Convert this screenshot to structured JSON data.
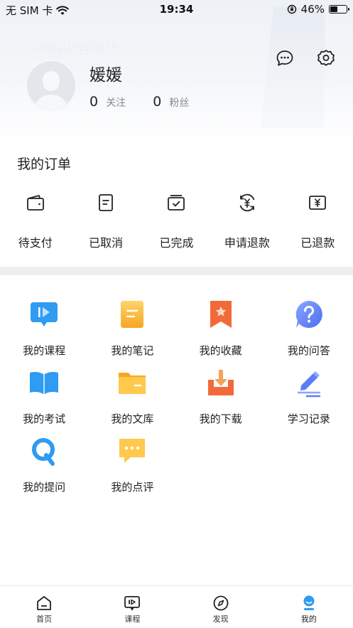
{
  "status_bar": {
    "carrier": "无 SIM 卡",
    "time": "19:34",
    "battery_percent_text": "46%",
    "battery_level": 0.46
  },
  "header": {
    "faint_text": "泰语培优在线课堂"
  },
  "profile": {
    "username": "媛媛",
    "following_count": "0",
    "following_label": "关注",
    "followers_count": "0",
    "followers_label": "粉丝"
  },
  "orders": {
    "title": "我的订单",
    "items": [
      {
        "label": "待支付",
        "icon": "wallet-icon"
      },
      {
        "label": "已取消",
        "icon": "document-icon"
      },
      {
        "label": "已完成",
        "icon": "completed-icon"
      },
      {
        "label": "申请退款",
        "icon": "refund-request-icon"
      },
      {
        "label": "已退款",
        "icon": "refunded-icon"
      }
    ]
  },
  "menu": {
    "items": [
      {
        "label": "我的课程",
        "icon": "course-icon",
        "color": "#2f9bf2"
      },
      {
        "label": "我的笔记",
        "icon": "note-icon",
        "color": "#f7b731"
      },
      {
        "label": "我的收藏",
        "icon": "bookmark-icon",
        "color": "#f26a3a"
      },
      {
        "label": "我的问答",
        "icon": "question-icon",
        "color": "#5b7df5"
      },
      {
        "label": "我的考试",
        "icon": "book-icon",
        "color": "#2f9bf2"
      },
      {
        "label": "我的文库",
        "icon": "folder-icon",
        "color": "#f7b731"
      },
      {
        "label": "我的下载",
        "icon": "download-icon",
        "color": "#f26a3a"
      },
      {
        "label": "学习记录",
        "icon": "pen-record-icon",
        "color": "#5b7df5"
      },
      {
        "label": "我的提问",
        "icon": "q-icon",
        "color": "#2f9bf2"
      },
      {
        "label": "我的点评",
        "icon": "comment-icon",
        "color": "#f7b731"
      }
    ]
  },
  "tabbar": {
    "items": [
      {
        "label": "首页",
        "icon": "home-icon"
      },
      {
        "label": "课程",
        "icon": "course-tab-icon"
      },
      {
        "label": "发现",
        "icon": "compass-icon"
      },
      {
        "label": "我的",
        "icon": "profile-icon",
        "active": true
      }
    ],
    "active_color": "#2f9bf2"
  }
}
